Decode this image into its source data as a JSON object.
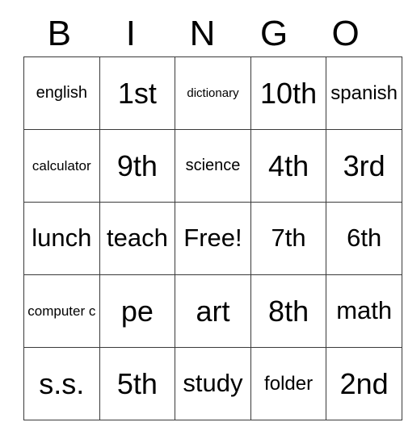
{
  "card": {
    "title": "BINGO",
    "header_letters": [
      "B",
      "I",
      "N",
      "G",
      "O"
    ],
    "grid_columns": 5,
    "grid_rows": 5,
    "border_color": "#3a3a3a",
    "background_color": "#ffffff",
    "text_color": "#000000",
    "free_space": "Free!",
    "cells": [
      [
        {
          "label": "english",
          "size": "sm"
        },
        {
          "label": "1st",
          "size": "xl"
        },
        {
          "label": "dictionary",
          "size": "xxs"
        },
        {
          "label": "10th",
          "size": "xl"
        },
        {
          "label": "spanish",
          "size": "md"
        }
      ],
      [
        {
          "label": "calculator",
          "size": "xs"
        },
        {
          "label": "9th",
          "size": "xl"
        },
        {
          "label": "science",
          "size": "sm"
        },
        {
          "label": "4th",
          "size": "xl"
        },
        {
          "label": "3rd",
          "size": "xl"
        }
      ],
      [
        {
          "label": "lunch",
          "size": "lg"
        },
        {
          "label": "teach",
          "size": "lg"
        },
        {
          "label": "Free!",
          "size": "lg"
        },
        {
          "label": "7th",
          "size": "lg"
        },
        {
          "label": "6th",
          "size": "lg"
        }
      ],
      [
        {
          "label": "computer c",
          "size": "xs"
        },
        {
          "label": "pe",
          "size": "xl"
        },
        {
          "label": "art",
          "size": "xl"
        },
        {
          "label": "8th",
          "size": "xl"
        },
        {
          "label": "math",
          "size": "lg"
        }
      ],
      [
        {
          "label": "s.s.",
          "size": "xl"
        },
        {
          "label": "5th",
          "size": "xl"
        },
        {
          "label": "study",
          "size": "lg"
        },
        {
          "label": "folder",
          "size": "md"
        },
        {
          "label": "2nd",
          "size": "xl"
        }
      ]
    ]
  }
}
